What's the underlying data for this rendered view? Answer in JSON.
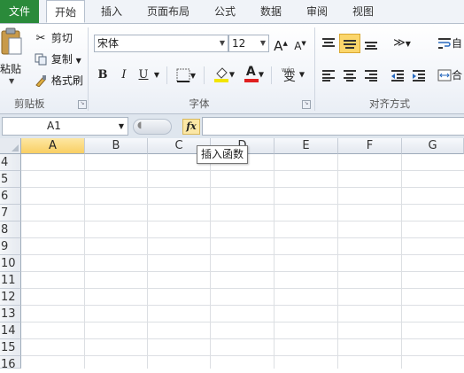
{
  "tabs": [
    {
      "label": "文件"
    },
    {
      "label": "开始"
    },
    {
      "label": "插入"
    },
    {
      "label": "页面布局"
    },
    {
      "label": "公式"
    },
    {
      "label": "数据"
    },
    {
      "label": "审阅"
    },
    {
      "label": "视图"
    }
  ],
  "clipboard": {
    "paste": "粘贴",
    "cut": "剪切",
    "copy": "复制",
    "format_painter": "格式刷",
    "group_label": "剪贴板"
  },
  "font": {
    "name": "宋体",
    "size": "12",
    "grow": "A",
    "shrink": "A",
    "bold": "B",
    "italic": "I",
    "underline": "U",
    "font_color_glyph": "A",
    "phonetic": "变",
    "group_label": "字体"
  },
  "alignment": {
    "wrap_label": "自",
    "merge_label": "合",
    "group_label": "对齐方式"
  },
  "formula_bar": {
    "name_box": "A1",
    "fx": "fx",
    "tooltip": "插入函数"
  },
  "columns": [
    "A",
    "B",
    "C",
    "D",
    "E",
    "F",
    "G"
  ],
  "rows": [
    "4",
    "5",
    "6",
    "7",
    "8",
    "9",
    "10",
    "11",
    "12",
    "13",
    "14",
    "15",
    "16"
  ],
  "colors": {
    "file_tab": "#2a8a3a",
    "selection_header": "#f9cf63",
    "font_color_bar": "#e02020",
    "highlight_bar": "#f2e500"
  },
  "icons": [
    "paste-icon",
    "cut-icon",
    "copy-icon",
    "format-painter-icon",
    "border-icon",
    "fill-color-icon",
    "font-color-icon",
    "phonetic-icon",
    "align-top-icon",
    "align-middle-icon",
    "align-bottom-icon",
    "orientation-icon",
    "align-left-icon",
    "align-center-icon",
    "align-right-icon",
    "decrease-indent-icon",
    "increase-indent-icon",
    "wrap-text-icon",
    "merge-icon",
    "insert-function-icon"
  ]
}
